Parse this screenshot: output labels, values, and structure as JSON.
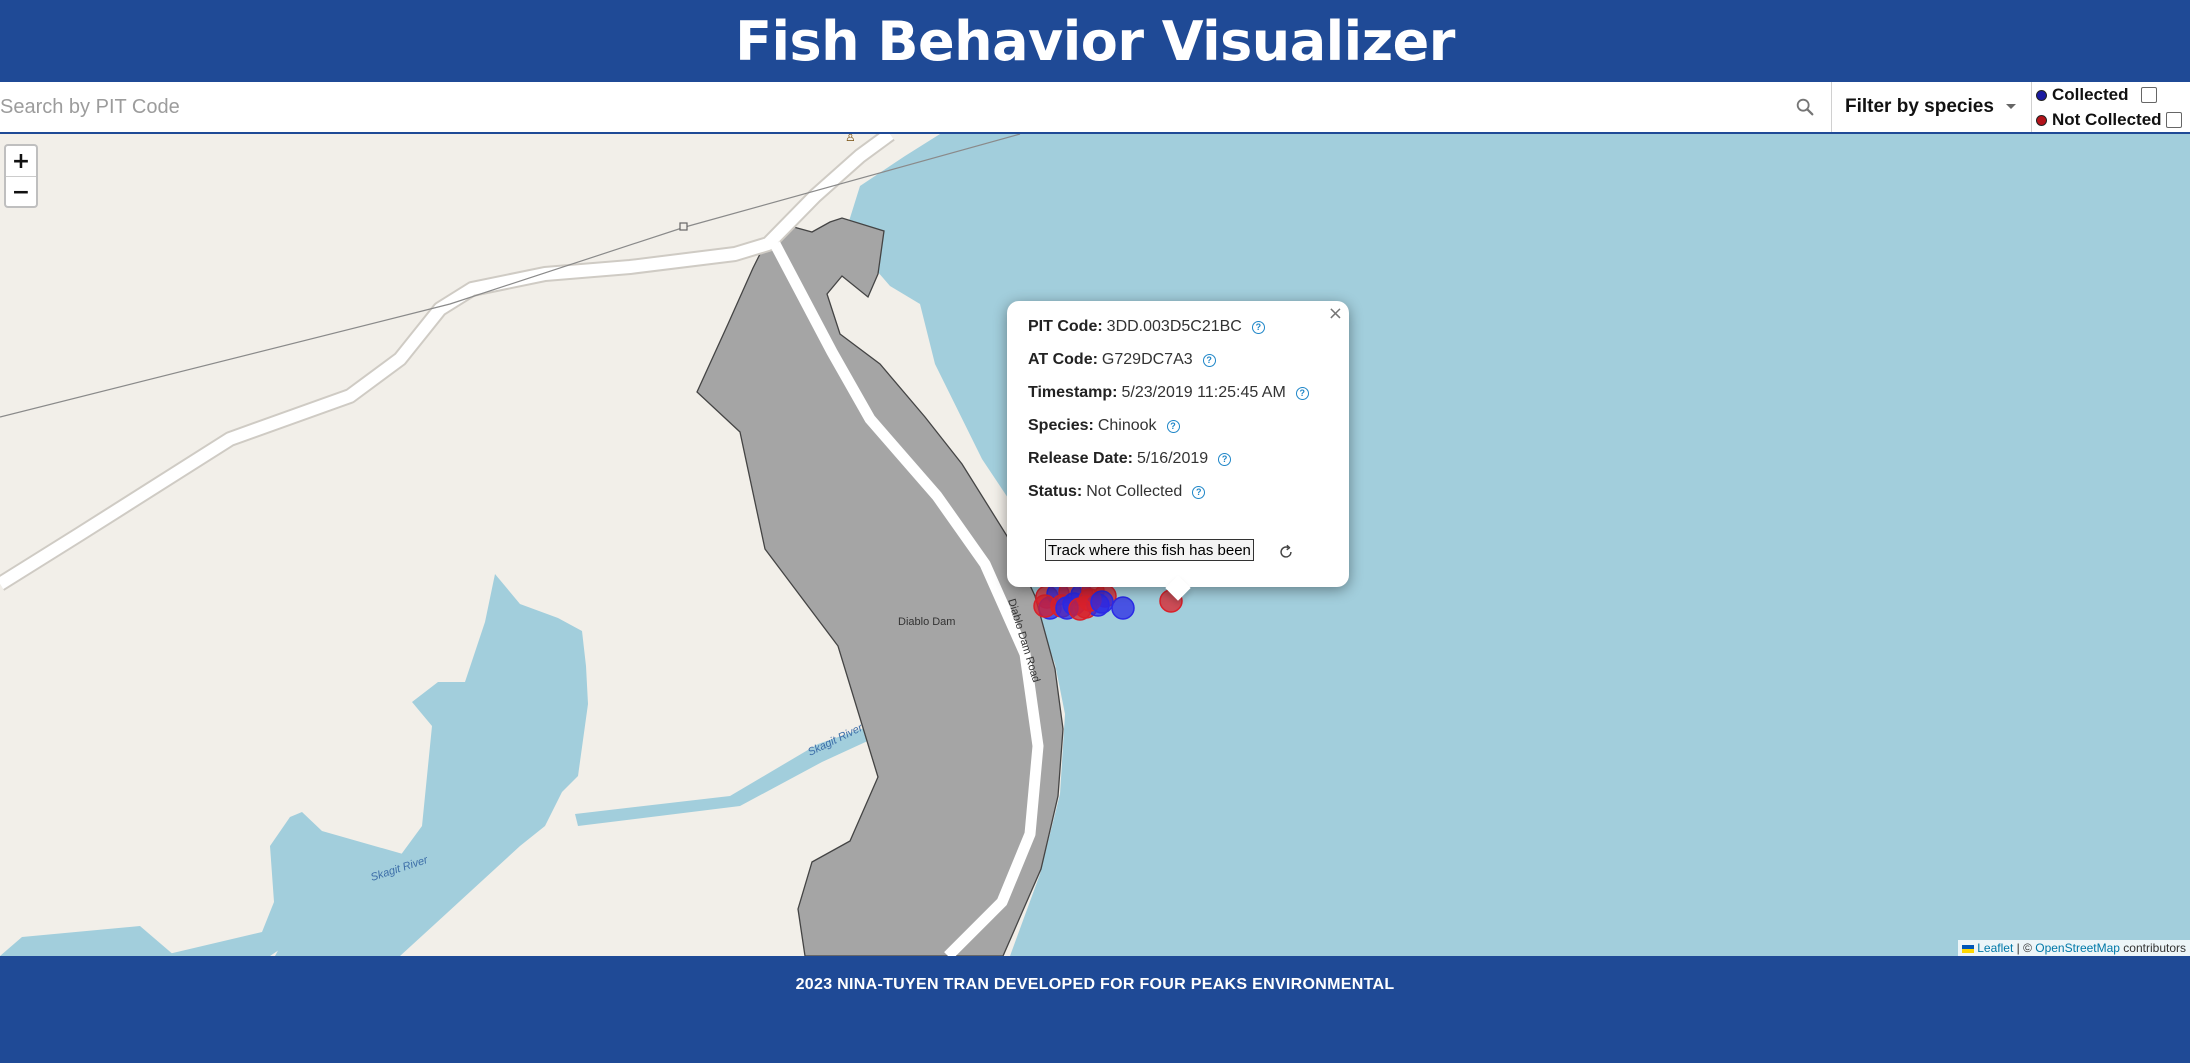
{
  "app": {
    "title": "Fish Behavior Visualizer"
  },
  "toolbar": {
    "search_placeholder": "Search by PIT Code",
    "search_value": "",
    "search_icon": "search-icon",
    "species_filter_label": "Filter by species",
    "legend": [
      {
        "label": "Collected",
        "color": "#1a1aa0",
        "checked": false
      },
      {
        "label": "Not Collected",
        "color": "#b3131a",
        "checked": false
      }
    ]
  },
  "map": {
    "zoom_in": "+",
    "zoom_out": "−",
    "labels": {
      "dam": "Diablo Dam",
      "road": "Diablo Dam Road",
      "river_1": "Skagit River",
      "river_2": "Skagit River"
    },
    "attribution": {
      "leaflet": "Leaflet",
      "separator": " | © ",
      "osm": "OpenStreetMap",
      "suffix": " contributors"
    },
    "marker_colors": {
      "collected": "#2a2ae6",
      "not_collected": "#d9202a"
    }
  },
  "popup": {
    "fields": [
      {
        "label": "PIT Code:",
        "value": "3DD.003D5C21BC"
      },
      {
        "label": "AT Code:",
        "value": "G729DC7A3"
      },
      {
        "label": "Timestamp:",
        "value": "5/23/2019 11:25:45 AM"
      },
      {
        "label": "Species:",
        "value": "Chinook"
      },
      {
        "label": "Release Date:",
        "value": "5/16/2019"
      },
      {
        "label": "Status:",
        "value": "Not Collected"
      }
    ],
    "help_glyph": "?",
    "track_button": "Track where this fish has been",
    "close": "×"
  },
  "footer": {
    "text": "2023 NINA-TUYEN TRAN DEVELOPED FOR FOUR PEAKS ENVIRONMENTAL"
  }
}
